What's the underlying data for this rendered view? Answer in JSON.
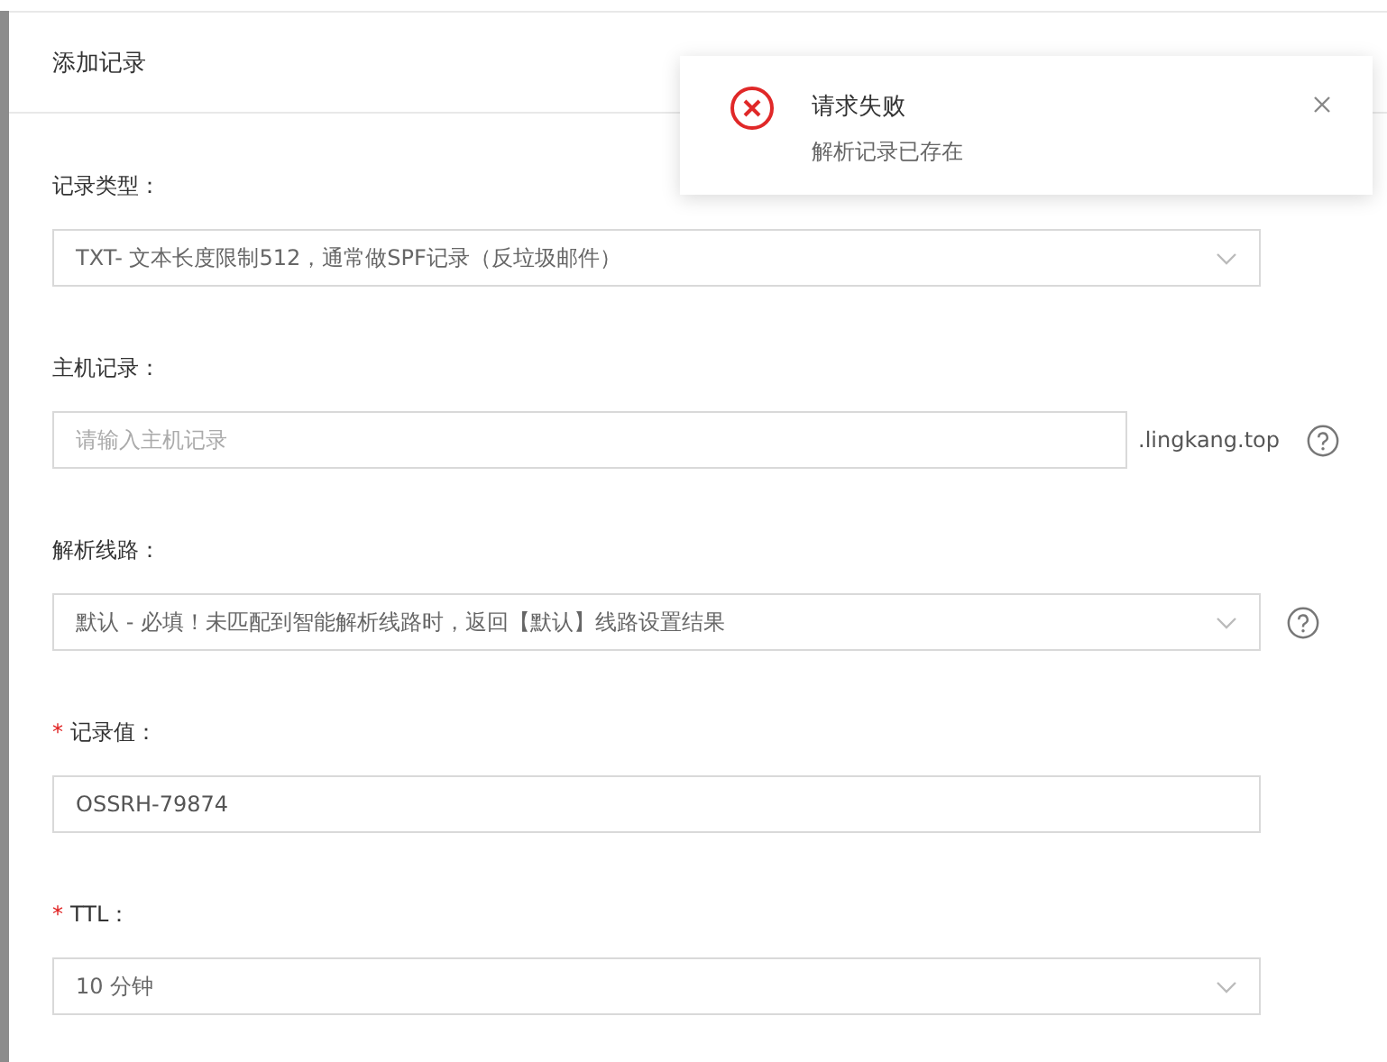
{
  "dialog": {
    "title": "添加记录"
  },
  "fields": [
    {
      "label": "记录类型：",
      "kind": "select",
      "value": "TXT- 文本长度限制512，通常做SPF记录（反垃圾邮件）",
      "help": false
    },
    {
      "label": "主机记录：",
      "kind": "input",
      "placeholder": "请输入主机记录",
      "suffix": ".lingkang.top",
      "help": true
    },
    {
      "label": "解析线路：",
      "kind": "select",
      "value": "默认 - 必填！未匹配到智能解析线路时，返回【默认】线路设置结果",
      "help": true
    },
    {
      "label": "记录值：",
      "required_mark": "*",
      "kind": "input",
      "value": "OSSRH-79874",
      "help": false
    },
    {
      "label": "TTL：",
      "required_mark": "*",
      "kind": "select",
      "value": "10 分钟",
      "help": false
    }
  ],
  "notification": {
    "title": "请求失败",
    "message": "解析记录已存在",
    "kind": "error"
  }
}
